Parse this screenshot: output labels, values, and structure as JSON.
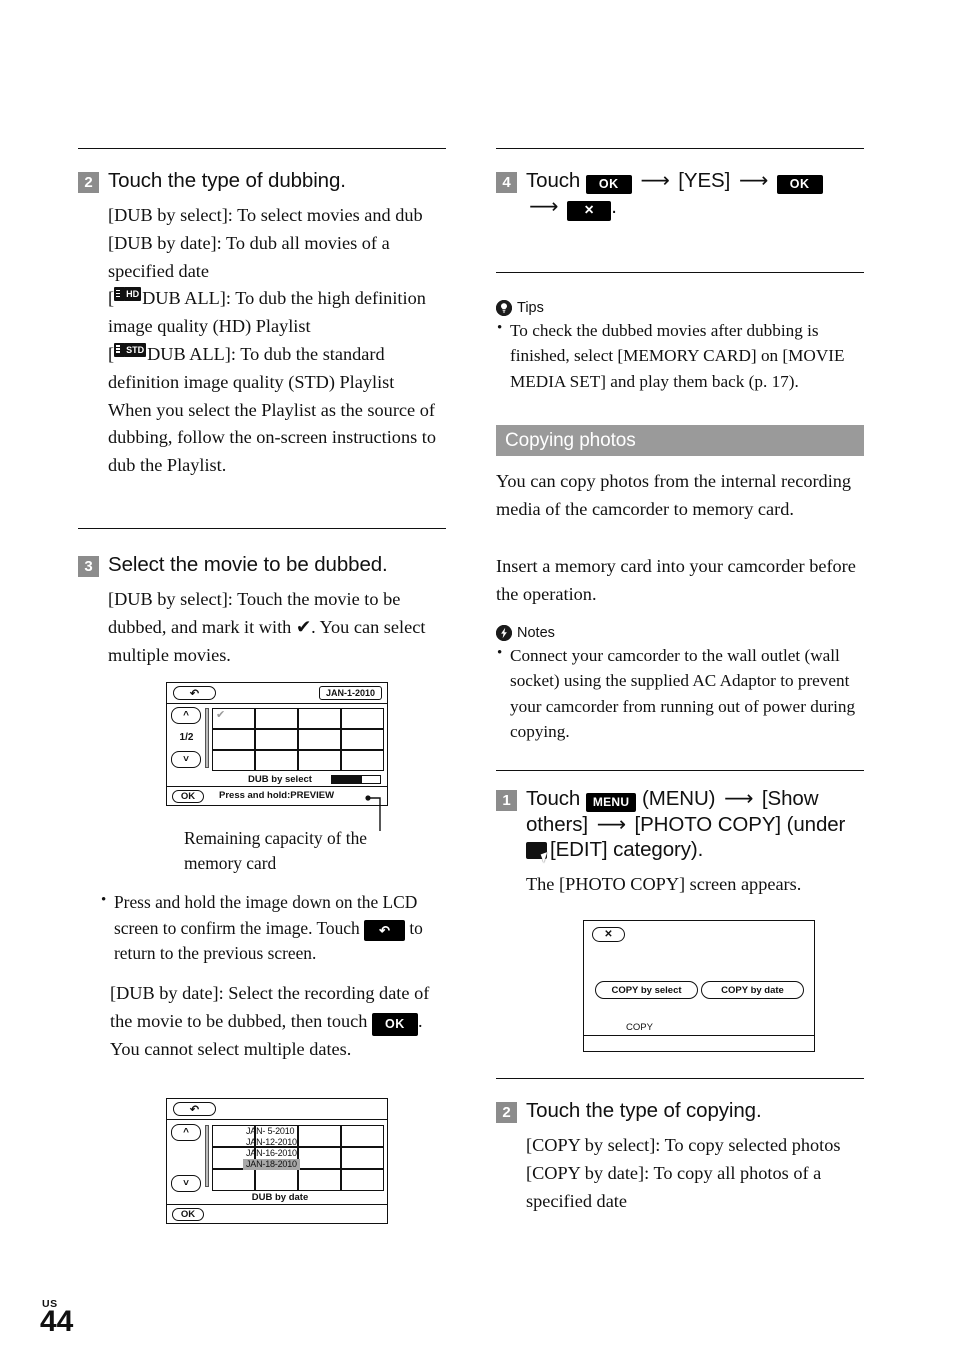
{
  "page": {
    "locale": "US",
    "number": "44"
  },
  "left_column": {
    "step2": {
      "number": "2",
      "heading": "Touch the type of dubbing.",
      "lines": [
        "[DUB by select]: To select movies and dub",
        "[DUB by date]: To dub all movies of a specified date"
      ],
      "hd_line_prefix": "[",
      "hd_tag": "HD",
      "hd_line_suffix": "DUB ALL]: To dub the high definition image quality (HD) Playlist",
      "std_tag": "STD",
      "std_line_suffix": "DUB ALL]: To dub the standard definition image quality (STD) Playlist",
      "closing": "When you select the Playlist as the source of dubbing, follow the on-screen instructions to dub the Playlist."
    },
    "step3": {
      "number": "3",
      "heading": "Select the movie to be dubbed.",
      "intro": "[DUB by select]: Touch the movie to be dubbed, and mark it with ✔. You can select multiple movies.",
      "screen_select": {
        "back_icon": "back-arrow-icon",
        "date_badge": "JAN-1-2010",
        "up_icon": "chevron-up-icon",
        "down_icon": "chevron-down-icon",
        "page_indicator": "1/2",
        "checkmark": "✔",
        "mode_label": "DUB by select",
        "ok_label": "OK",
        "hint_label": "Press and hold:PREVIEW"
      },
      "caption": "Remaining capacity of the memory card",
      "bullet": {
        "before": "Press and hold the image down on the LCD screen to confirm the image. Touch",
        "after": "to return to the previous screen."
      },
      "by_date_before": "[DUB by date]: Select the recording date of the movie to be dubbed, then touch",
      "by_date_after": ". You cannot select multiple dates.",
      "screen_date": {
        "back_icon": "back-arrow-icon",
        "up_icon": "chevron-up-icon",
        "down_icon": "chevron-down-icon",
        "dates": [
          "JAN- 5-2010",
          "JAN-12-2010",
          "JAN-16-2010",
          "JAN-18-2010"
        ],
        "selected_date": "JAN-18-2010",
        "mode_label": "DUB by date",
        "ok_label": "OK"
      }
    }
  },
  "right_column": {
    "step4": {
      "number": "4",
      "touch_label": "Touch",
      "ok_label": "OK",
      "yes_label": "[YES]",
      "close_label": "✕",
      "arrow": "⟶",
      "period": "."
    },
    "tips": {
      "icon": "lightbulb-icon",
      "title": "Tips",
      "items": [
        "To check the dubbed movies after dubbing is finished, select [MEMORY CARD] on [MOVIE MEDIA SET] and play them back (p. 17)."
      ]
    },
    "section": {
      "title": "Copying photos"
    },
    "intro": [
      "You can copy photos from the internal recording media of the camcorder to memory card.",
      "Insert a memory card into your camcorder before the operation."
    ],
    "notes": {
      "icon": "lightning-icon",
      "title": "Notes",
      "items": [
        "Connect your camcorder to the wall outlet (wall socket) using the supplied AC Adaptor to prevent your camcorder from running out of power during copying."
      ]
    },
    "step1": {
      "number": "1",
      "touch_label": "Touch",
      "menu_badge": "MENU",
      "menu_paren": "(MENU)",
      "show_others": "[Show others]",
      "photo_copy": "[PHOTO COPY]",
      "under_label": "(under",
      "edit_icon": "edit-category-icon",
      "edit_label": "[EDIT] category).",
      "result": "The [PHOTO COPY] screen appears.",
      "screen": {
        "close_label": "✕",
        "button_select": "COPY by select",
        "button_date": "COPY by date",
        "footer_label": "COPY"
      }
    },
    "step2": {
      "number": "2",
      "heading": "Touch the type of copying.",
      "lines": [
        "[COPY by select]: To copy selected photos",
        "[COPY by date]: To copy all photos of a specified date"
      ]
    }
  }
}
